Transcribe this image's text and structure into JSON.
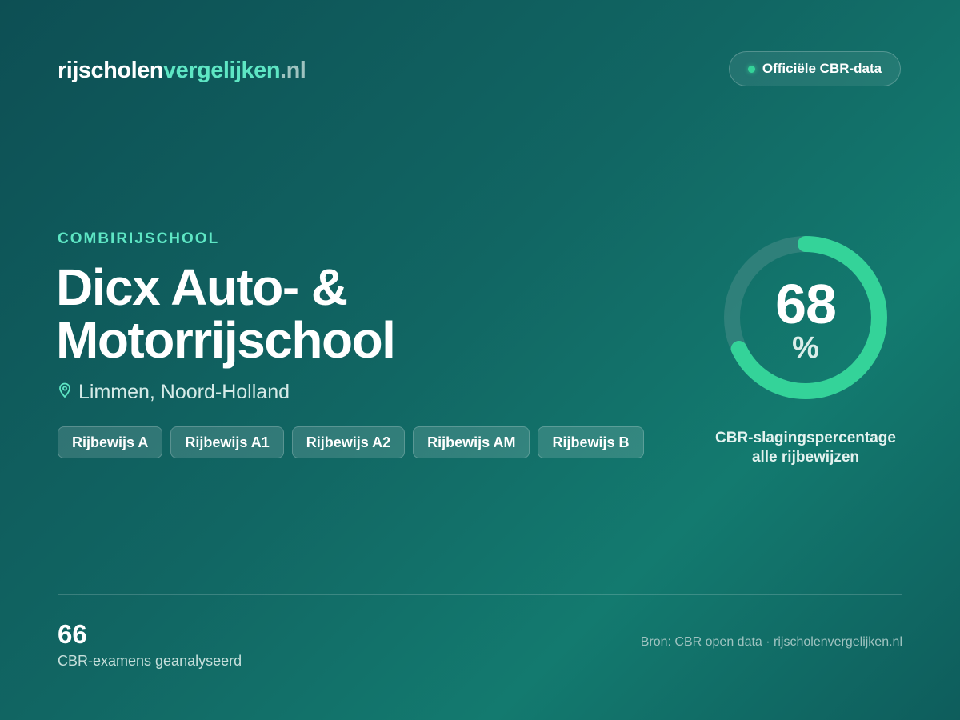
{
  "header": {
    "logo": {
      "part1": "rijscholen",
      "part2": "vergelijken",
      "part3": ".nl"
    },
    "badge": "Officiële CBR-data"
  },
  "school": {
    "category": "COMBIRIJSCHOOL",
    "name": "Dicx Auto- & Motorrijschool",
    "location": "Limmen, Noord-Holland",
    "licenses": [
      "Rijbewijs A",
      "Rijbewijs A1",
      "Rijbewijs A2",
      "Rijbewijs AM",
      "Rijbewijs B"
    ]
  },
  "score": {
    "value": "68",
    "unit": "%",
    "percent": 68,
    "caption_line1": "CBR-slagingspercentage",
    "caption_line2": "alle rijbewijzen"
  },
  "footer": {
    "exams_count": "66",
    "exams_label": "CBR-examens geanalyseerd",
    "source": "Bron: CBR open data · rijscholenvergelijken.nl"
  },
  "colors": {
    "accent": "#5ee6c4",
    "gauge_fill": "#34d399",
    "gauge_track": "#3a8580"
  },
  "icons": {
    "location": "map-pin-icon",
    "status": "status-dot-icon"
  }
}
